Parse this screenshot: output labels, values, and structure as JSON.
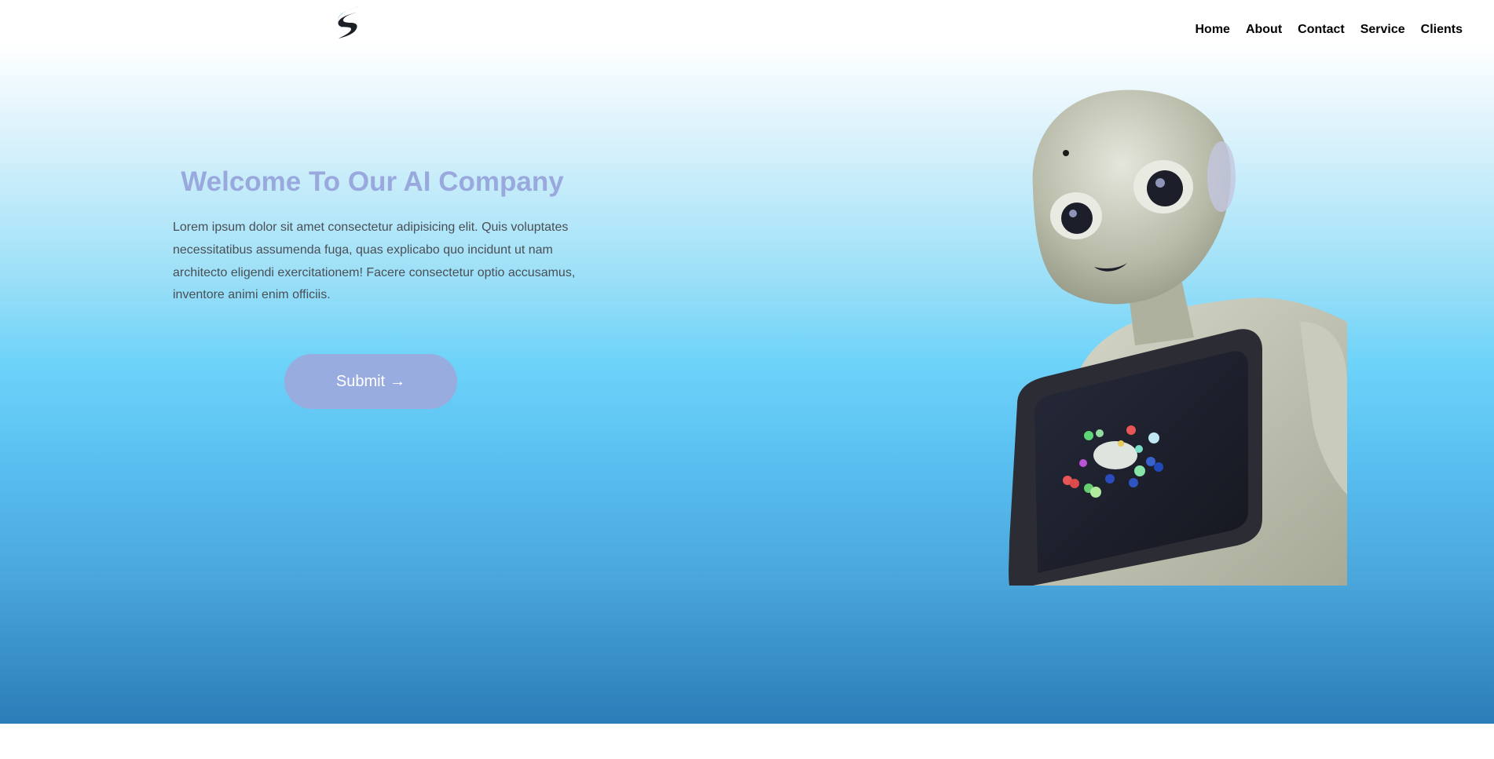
{
  "nav": {
    "items": [
      "Home",
      "About",
      "Contact",
      "Service",
      "Clients"
    ]
  },
  "hero": {
    "title": "Welcome To Our AI Company",
    "description": "Lorem ipsum dolor sit amet consectetur adipisicing elit. Quis voluptates necessitatibus assumenda fuga, quas explicabo quo incidunt ut nam architecto eligendi exercitationem! Facere consectetur optio accusamus, inventore animi enim officiis.",
    "submit_label": "Submit",
    "submit_icon": "→"
  },
  "colors": {
    "title": "#99a9dd",
    "button": "#98acdf",
    "gradient_top": "#ffffff",
    "gradient_mid": "#6ed3f9",
    "gradient_bottom": "#2b7db8"
  },
  "icons": {
    "logo": "s-wing-logo-icon",
    "robot": "robot-image"
  }
}
